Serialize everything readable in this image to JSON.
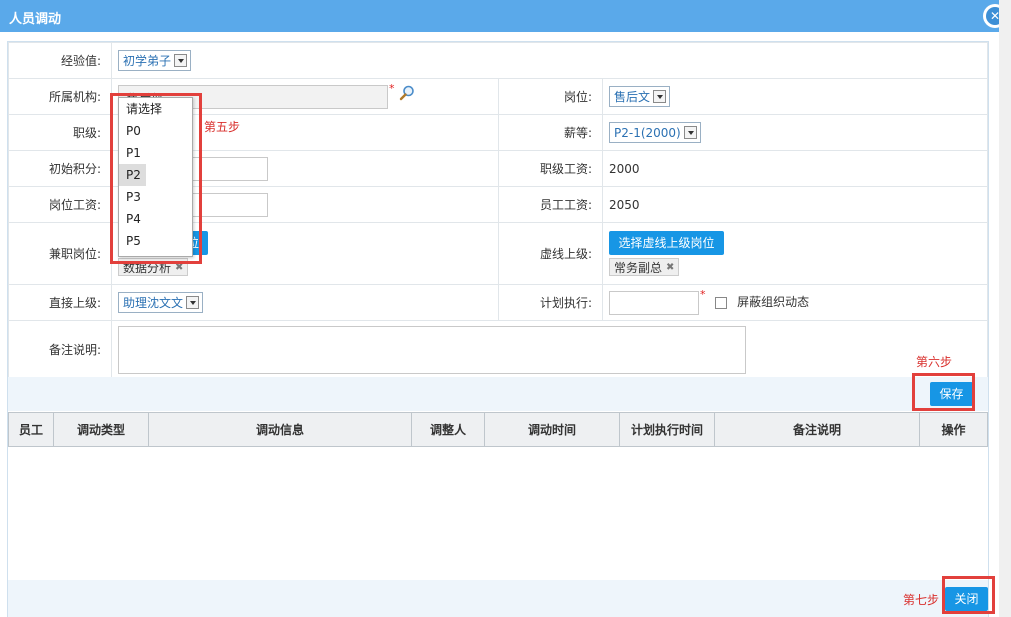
{
  "dialog": {
    "title": "人员调动",
    "close_icon": "close-icon"
  },
  "form": {
    "experience": {
      "label": "经验值:",
      "value": "初学弟子"
    },
    "org": {
      "label": "所属机构:",
      "value": "售后部"
    },
    "position": {
      "label": "岗位:",
      "value": "售后文"
    },
    "rank": {
      "label": "职级:"
    },
    "salary_grade": {
      "label": "薪等:",
      "value": "P2-1(2000)"
    },
    "initial_points": {
      "label": "初始积分:"
    },
    "rank_salary": {
      "label": "职级工资:",
      "value": "2000"
    },
    "post_salary": {
      "label": "岗位工资:"
    },
    "employee_salary": {
      "label": "员工工资:",
      "value": "2050"
    },
    "parttime_post": {
      "label": "兼职岗位:",
      "button": "选择兼职岗位",
      "tag": "数据分析"
    },
    "virtual_superior": {
      "label": "虚线上级:",
      "button": "选择虚线上级岗位",
      "tag": "常务副总"
    },
    "direct_superior": {
      "label": "直接上级:",
      "value": "助理沈文文"
    },
    "plan_exec": {
      "label": "计划执行:",
      "checkbox_label": "屏蔽组织动态"
    },
    "remark": {
      "label": "备注说明:"
    }
  },
  "dropdown": {
    "options": [
      "请选择",
      "P0",
      "P1",
      "P2",
      "P3",
      "P4",
      "P5"
    ],
    "selected_index": 3
  },
  "annotations": {
    "step5": "第五步",
    "step6": "第六步",
    "step7": "第七步"
  },
  "buttons": {
    "save": "保存",
    "close": "关闭"
  },
  "grid": {
    "columns": [
      "员工",
      "调动类型",
      "调动信息",
      "调整人",
      "调动时间",
      "计划执行时间",
      "备注说明",
      "操作"
    ]
  },
  "colors": {
    "titlebar": "#5aa9ea",
    "button": "#1796e5",
    "annotation": "#d9302d"
  }
}
